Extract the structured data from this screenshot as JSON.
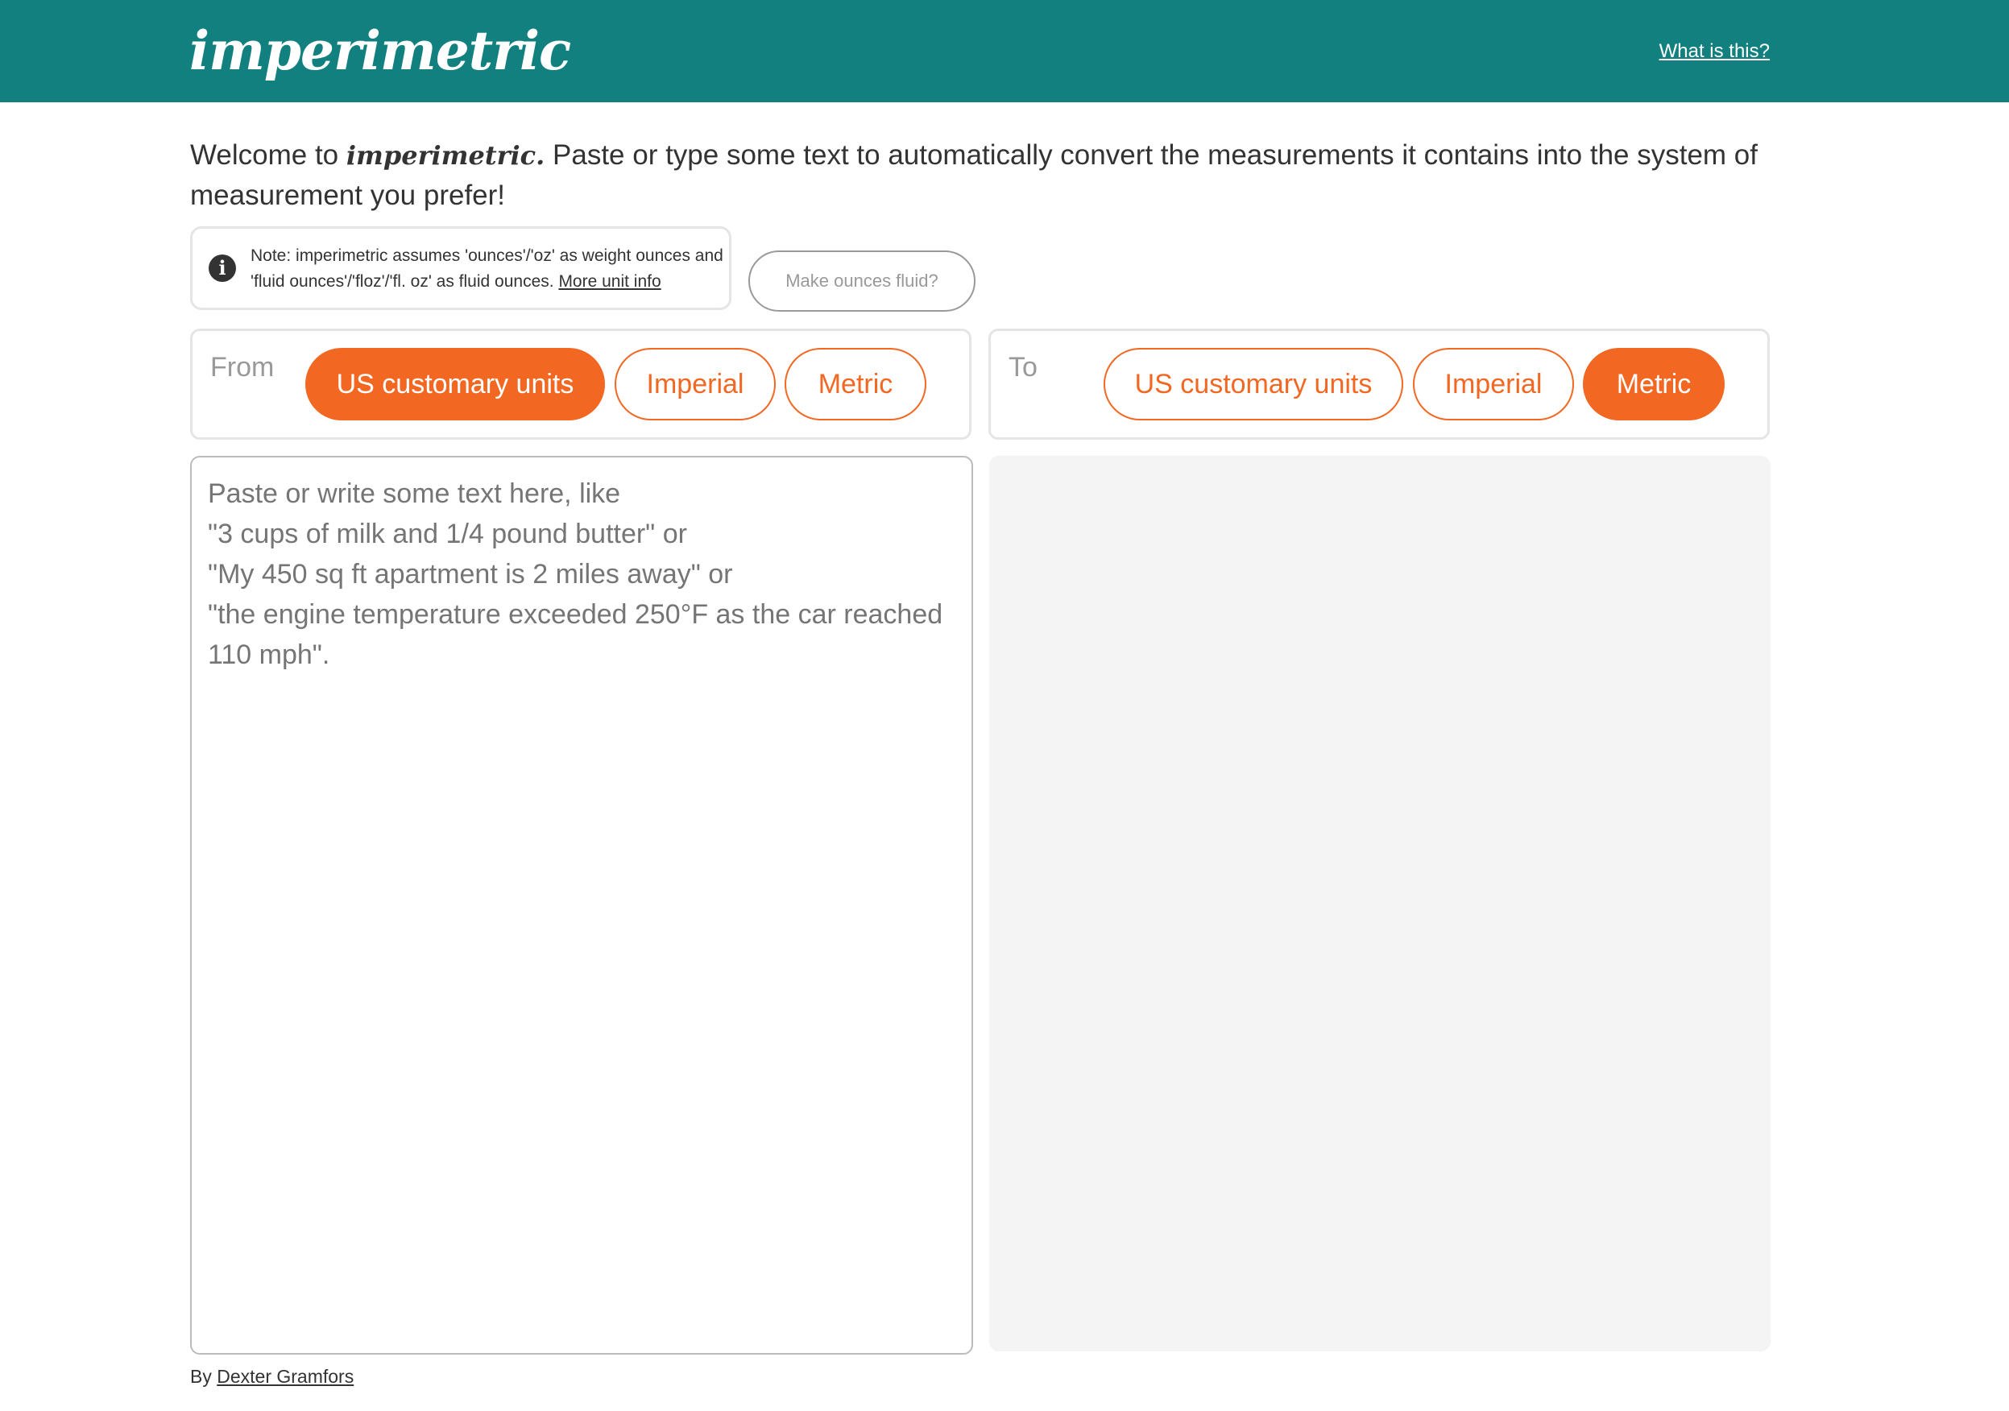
{
  "header": {
    "logo": "imperimetric",
    "what_link": "What is this?",
    "bg_color": "#138080"
  },
  "welcome": {
    "prefix": "Welcome to ",
    "brand": "imperimetric.",
    "suffix": " Paste or type some text to automatically convert the measurements it contains into the system of measurement you prefer!"
  },
  "note": {
    "icon": "info-icon",
    "text": "Note: imperimetric assumes 'ounces'/'oz' as weight ounces and 'fluid ounces'/'floz'/'fl. oz' as fluid ounces.",
    "link": "More unit info"
  },
  "fluid_button": "Make ounces fluid?",
  "from": {
    "label": "From",
    "options": [
      "US customary units",
      "Imperial",
      "Metric"
    ],
    "selected": "US customary units"
  },
  "to": {
    "label": "To",
    "options": [
      "US customary units",
      "Imperial",
      "Metric"
    ],
    "selected": "Metric"
  },
  "input": {
    "placeholder": "Paste or write some text here, like\n\"3 cups of milk and 1/4 pound butter\" or\n\"My 450 sq ft apartment is 2 miles away\" or\n\"the engine temperature exceeded 250°F as the car reached 110 mph\".",
    "value": ""
  },
  "output": {
    "value": ""
  },
  "footer": {
    "prefix": "By ",
    "author": "Dexter Gramfors"
  },
  "colors": {
    "accent": "#f26722",
    "header": "#138080",
    "output_bg": "#f4f4f4"
  }
}
